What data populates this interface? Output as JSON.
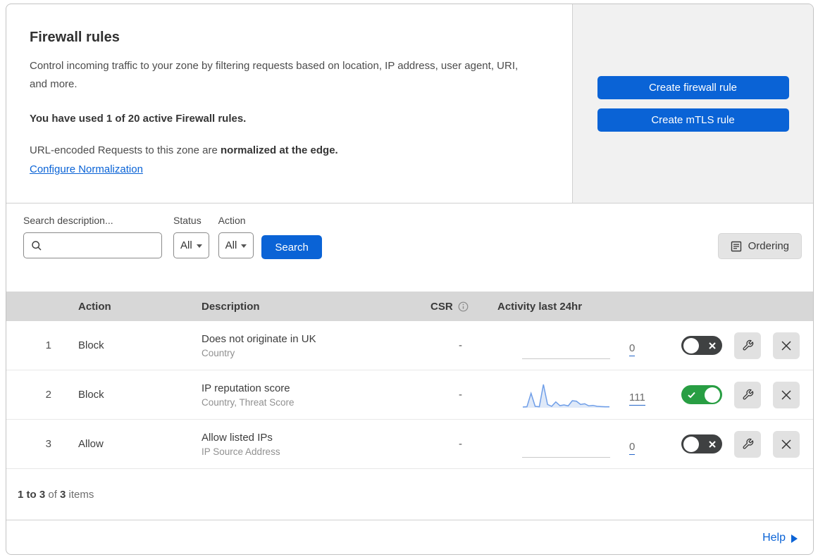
{
  "header": {
    "title": "Firewall rules",
    "description": "Control incoming traffic to your zone by filtering requests based on location, IP address, user agent, URI, and more.",
    "usage": "You have used 1 of 20 active Firewall rules.",
    "norm_prefix": "URL-encoded Requests to this zone are ",
    "norm_bold": "normalized at the edge.",
    "norm_link": "Configure Normalization",
    "buttons": [
      {
        "label": "Create firewall rule"
      },
      {
        "label": "Create mTLS rule"
      }
    ]
  },
  "filters": {
    "search_label": "Search description...",
    "status_label": "Status",
    "status_value": "All",
    "action_label": "Action",
    "action_value": "All",
    "search_button": "Search",
    "ordering_button": "Ordering"
  },
  "table": {
    "columns": {
      "action": "Action",
      "description": "Description",
      "csr": "CSR",
      "activity": "Activity last 24hr"
    },
    "rows": [
      {
        "index": "1",
        "action": "Block",
        "description": "Does not originate in UK",
        "criteria": "Country",
        "csr": "-",
        "count": "0",
        "enabled": false,
        "sparkline": []
      },
      {
        "index": "2",
        "action": "Block",
        "description": "IP reputation score",
        "criteria": "Country, Threat Score",
        "csr": "-",
        "count": "111",
        "enabled": true,
        "sparkline": [
          3,
          4,
          62,
          6,
          4,
          100,
          14,
          6,
          25,
          9,
          12,
          8,
          30,
          28,
          14,
          17,
          8,
          10,
          6,
          5,
          4,
          4
        ]
      },
      {
        "index": "3",
        "action": "Allow",
        "description": "Allow listed IPs",
        "criteria": "IP Source Address",
        "csr": "-",
        "count": "0",
        "enabled": false,
        "sparkline": []
      }
    ]
  },
  "footer": {
    "range": "1 to 3",
    "of": " of ",
    "total": "3",
    "items": " items"
  },
  "help": {
    "label": "Help"
  },
  "colors": {
    "accent_blue": "#0a63d6",
    "toggle_on_green": "#289e43",
    "toggle_off_gray": "#3f4142",
    "sparkline_blue": "#6f9ee8",
    "sparkline_fill": "#dfe9f8",
    "header_band_gray": "#d7d7d7",
    "panel_gray": "#f1f1f1"
  }
}
